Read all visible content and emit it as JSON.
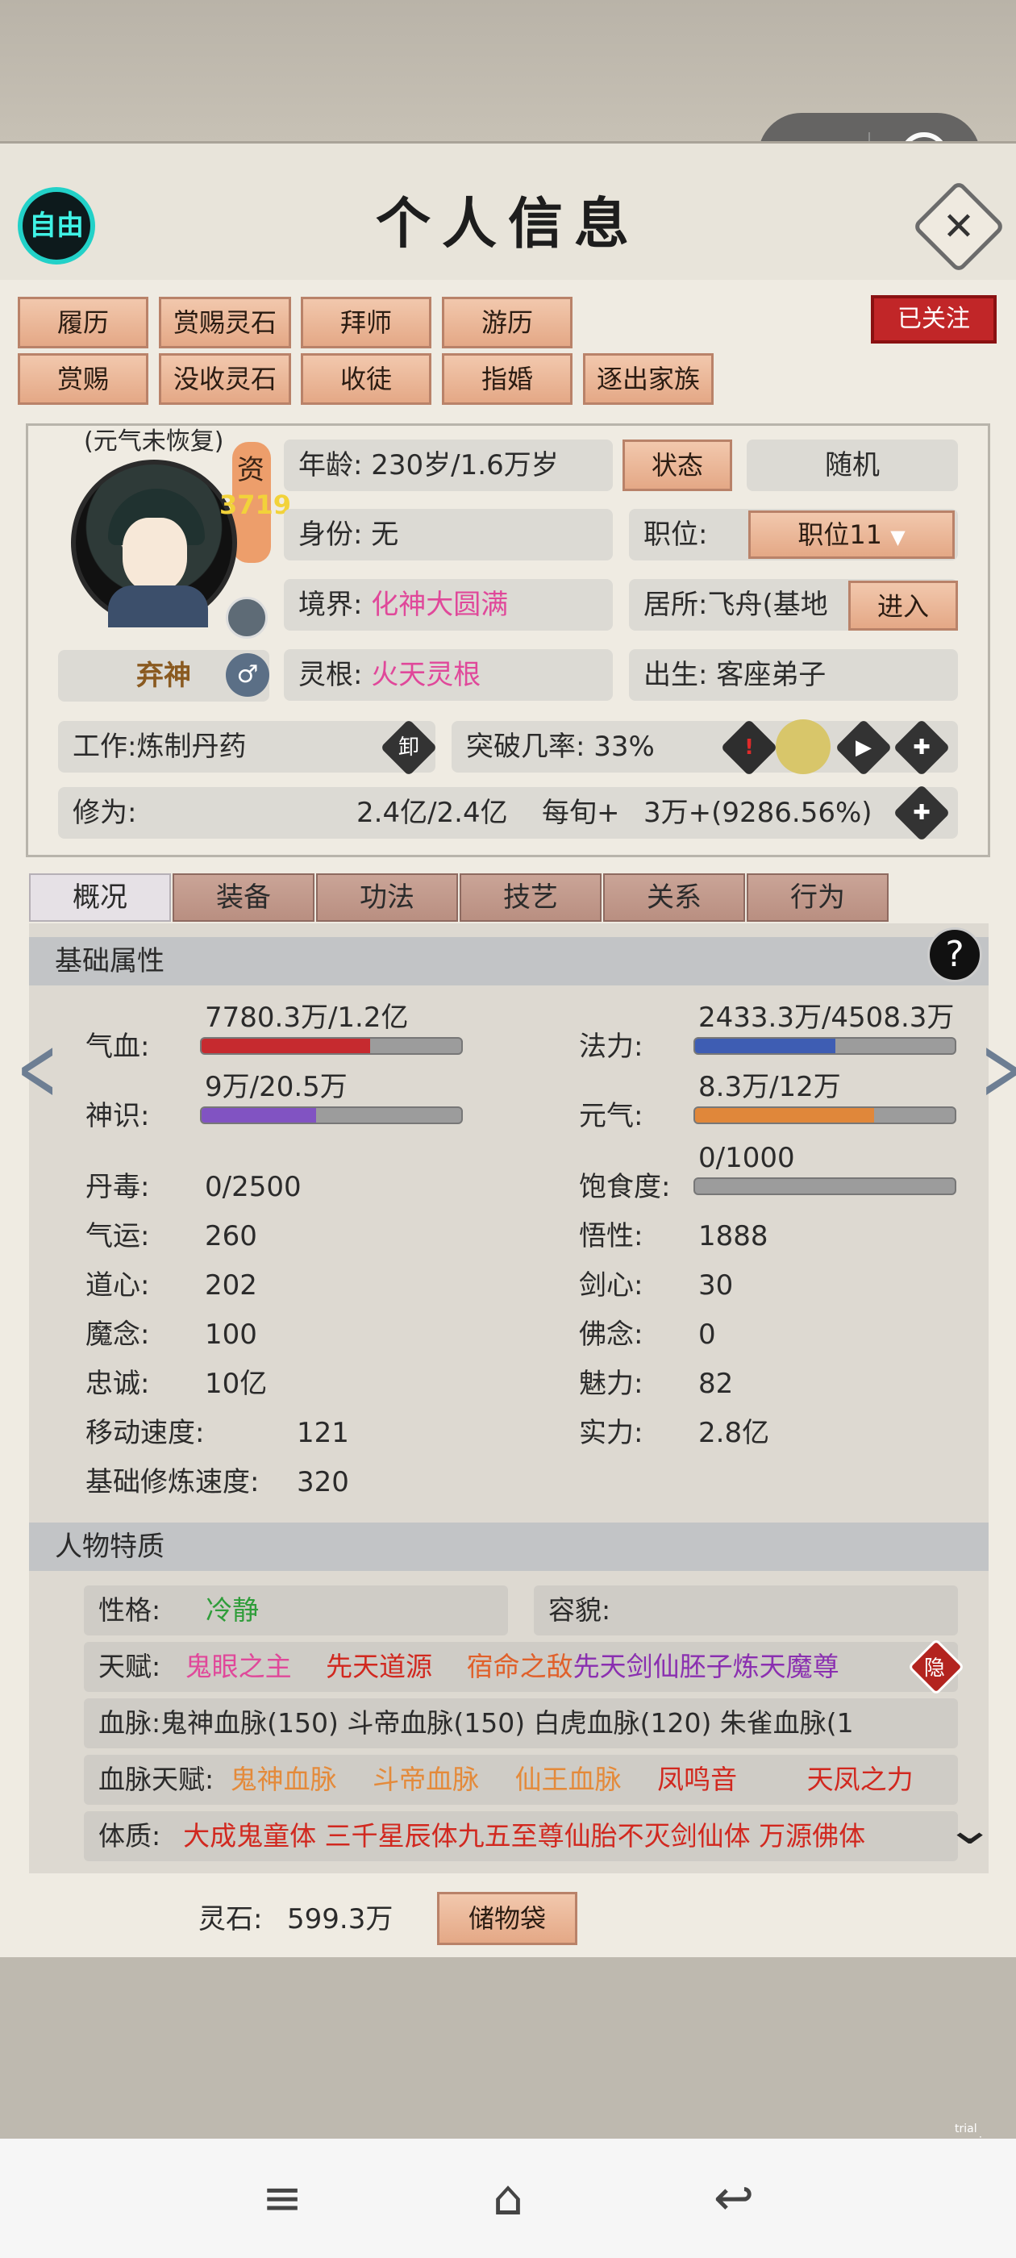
{
  "header": {
    "free_btn": "自由",
    "title": "个人信息",
    "close": "✕",
    "followed": "已关注"
  },
  "capsule": {
    "more": "•••"
  },
  "action_buttons": [
    "履历",
    "赏赐灵石",
    "拜师",
    "游历",
    "赏赐",
    "没收灵石",
    "收徒",
    "指婚",
    "逐出家族"
  ],
  "character": {
    "status_note": "(元气未恢复)",
    "zi_label": "资",
    "zi_value": "3719",
    "name": "弃神",
    "gender_icon": "♂",
    "age_label": "年龄:",
    "age_value": "230岁/1.6万岁",
    "state_btn": "状态",
    "random_btn": "随机",
    "identity_label": "身份:",
    "identity_value": "无",
    "position_label": "职位:",
    "position_value": "职位11",
    "realm_label": "境界:",
    "realm_value": "化神大圆满",
    "residence_label": "居所:",
    "residence_value": "飞舟(基地",
    "enter_btn": "进入",
    "root_label": "灵根:",
    "root_value": "火天灵根",
    "birth_label": "出生:",
    "birth_value": "客座弟子",
    "work_label": "工作:",
    "work_value": "炼制丹药",
    "unload_btn": "卸",
    "breakthrough_label": "突破几率:",
    "breakthrough_value": "33%",
    "cult_label": "修为:",
    "cult_value": "2.4亿/2.4亿",
    "cult_rate_label": "每旬+",
    "cult_rate_value": "3万+(9286.56%)"
  },
  "tabs": [
    "概况",
    "装备",
    "功法",
    "技艺",
    "关系",
    "行为"
  ],
  "basic": {
    "title": "基础属性",
    "help": "?",
    "hp_label": "气血:",
    "hp_value": "7780.3万/1.2亿",
    "mp_label": "法力:",
    "mp_value": "2433.3万/4508.3万",
    "sense_label": "神识:",
    "sense_value": "9万/20.5万",
    "vital_label": "元气:",
    "vital_value": "8.3万/12万",
    "satiety_label": "饱食度:",
    "satiety_value": "0/1000",
    "stats_left": [
      {
        "label": "丹毒:",
        "value": "0/2500"
      },
      {
        "label": "气运:",
        "value": "260"
      },
      {
        "label": "道心:",
        "value": "202"
      },
      {
        "label": "魔念:",
        "value": "100"
      },
      {
        "label": "忠诚:",
        "value": "10亿"
      },
      {
        "label": "移动速度:",
        "value": "121"
      },
      {
        "label": "基础修炼速度:",
        "value": "320"
      }
    ],
    "stats_right": [
      {
        "label": "悟性:",
        "value": "1888"
      },
      {
        "label": "剑心:",
        "value": "30"
      },
      {
        "label": "佛念:",
        "value": "0"
      },
      {
        "label": "魅力:",
        "value": "82"
      },
      {
        "label": "实力:",
        "value": "2.8亿"
      }
    ],
    "bars": {
      "hp": 0.65,
      "mp": 0.54,
      "sense": 0.44,
      "vital": 0.69,
      "satiety": 0.0
    }
  },
  "traits": {
    "title": "人物特质",
    "personality_label": "性格:",
    "personality_value": "冷静",
    "looks_label": "容貌:",
    "talent_label": "天赋:",
    "talents": [
      "鬼眼之主",
      "先天道源",
      "宿命之敌",
      "先天剑仙胚子",
      "炼天魔尊"
    ],
    "hide_btn": "隐",
    "blood_label": "血脉:",
    "bloods": "鬼神血脉(150)  斗帝血脉(150)  白虎血脉(120)  朱雀血脉(1",
    "blood_talent_label": "血脉天赋:",
    "blood_talents": [
      "鬼神血脉",
      "斗帝血脉",
      "仙王血脉",
      "凤鸣音",
      "天凤之力"
    ],
    "physique_label": "体质:",
    "physiques": "大成鬼童体 三千星辰体九五至尊仙胎不灭剑仙体  万源佛体"
  },
  "footer": {
    "stone_label": "灵石:",
    "stone_value": "599.3万",
    "bag_btn": "储物袋"
  },
  "system_nav": {
    "menu": "≡",
    "home": "⌂",
    "back": "↩"
  },
  "trial": "trial version",
  "colors": {
    "hp": "#c62a2f",
    "mp": "#3e5db3",
    "sense": "#8153c2",
    "vital": "#e0873a",
    "pink": "#e0489a",
    "red": "#d1281f",
    "orange": "#e48a3a",
    "purple": "#8a2fb0",
    "green": "#2f9d3a"
  }
}
